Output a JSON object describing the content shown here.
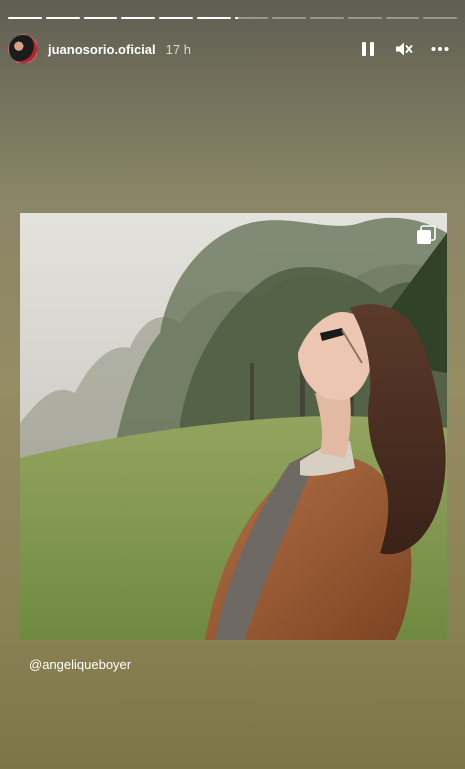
{
  "story": {
    "segments": [
      1,
      1,
      1,
      1,
      1,
      1,
      0.1,
      0,
      0,
      0,
      0,
      0
    ],
    "username": "juanosorio.oficial",
    "time_ago": "17 h"
  },
  "controls": {
    "icons": [
      "pause-icon",
      "mute-icon",
      "more-icon"
    ]
  },
  "content": {
    "mention": "@angeliqueboyer"
  },
  "colors": {
    "accent": "#ffffff",
    "background": "#8a8566"
  }
}
